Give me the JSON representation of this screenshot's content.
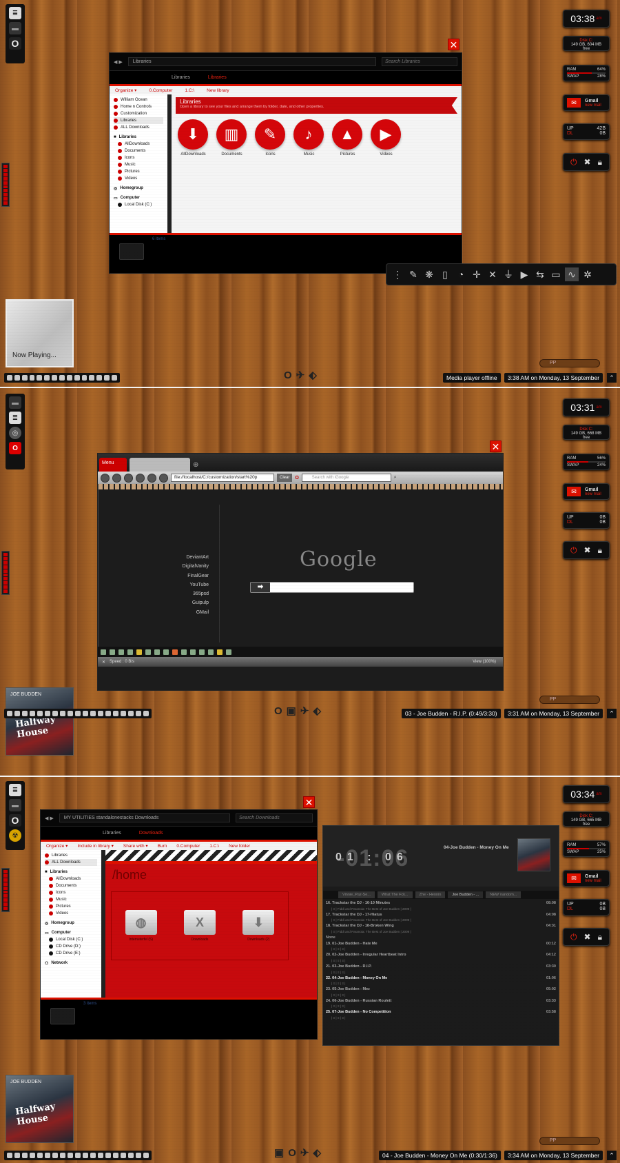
{
  "panel1": {
    "clock": {
      "time": "03:38",
      "ampm": "am"
    },
    "disk": {
      "label": "Disk C:",
      "value": "149 GB, 604 MB free"
    },
    "ram": {
      "ram_label": "RAM",
      "ram_val": "64%",
      "swap_label": "SWAP",
      "swap_val": "28%",
      "ram_pct": 64,
      "swap_pct": 28
    },
    "gmail": {
      "title": "Gmail",
      "sub": "new mail"
    },
    "net": {
      "up_label": "UP",
      "up": "42B",
      "dl_label": "DL",
      "dl": "0B"
    },
    "explorer": {
      "address": "Libraries",
      "search": "Search Libraries",
      "tabs": [
        "Libraries",
        "Libraries"
      ],
      "commands": [
        "Organize ▾",
        "0.Computer",
        "1.C:\\",
        "New library"
      ],
      "nav": [
        "William Ocean",
        "Home n Controls",
        "Customization",
        "Libraries",
        "ALL Downloads"
      ],
      "nav_libs_header": "Libraries",
      "nav_libs": [
        "AllDownloads",
        "Documents",
        "Icons",
        "Music",
        "Pictures",
        "Videos"
      ],
      "homegroup": "Homegroup",
      "computer": "Computer",
      "local_disk": "Local Disk (C:)",
      "banner_title": "Libraries",
      "banner_sub": "Open a library to see your files and arrange them by folder, date, and other properties.",
      "libraries": [
        "AllDownloads",
        "Documents",
        "Icons",
        "Music",
        "Pictures",
        "Videos"
      ],
      "status": "6 items"
    },
    "now_playing": "Now Playing...",
    "media_status": "Media player offline",
    "datetime": "3:38 AM on Monday, 13 September",
    "search_placeholder": "PP"
  },
  "panel2": {
    "clock": {
      "time": "03:31",
      "ampm": "am"
    },
    "disk": {
      "label": "Disk C:",
      "value": "149 GB, 668 MB free"
    },
    "ram": {
      "ram_label": "RAM",
      "ram_val": "56%",
      "swap_label": "SWAP",
      "swap_val": "24%",
      "ram_pct": 56,
      "swap_pct": 24
    },
    "gmail": {
      "title": "Gmail",
      "sub": "new mail"
    },
    "net": {
      "up_label": "UP",
      "up": "0B",
      "dl_label": "DL",
      "dl": "0B"
    },
    "browser": {
      "menu": "Menu",
      "url": "file://localhost/C:/customization/start%20p",
      "go": "Clear",
      "search": "Search with iGoogle",
      "links": [
        "DeviantArt",
        "DigitalVanity",
        "FinalGear",
        "YouTube",
        "365psd",
        "Guipulp",
        "GMail"
      ],
      "logo": "Google",
      "speed": "Speed : 0 B/s",
      "zoom": "View (100%)"
    },
    "track": "03 - Joe Budden - R.I.P. (0:49/3:30)",
    "datetime": "3:31 AM on Monday, 13 September",
    "album_artist": "JOE BUDDEN",
    "album_title": "Halfway House",
    "search_placeholder": "PP"
  },
  "panel3": {
    "clock": {
      "time": "03:34",
      "ampm": "am"
    },
    "disk": {
      "label": "Disk C:",
      "value": "149 GB, 665 MB free"
    },
    "ram": {
      "ram_label": "RAM",
      "ram_val": "57%",
      "swap_label": "SWAP",
      "swap_val": "25%",
      "ram_pct": 57,
      "swap_pct": 25
    },
    "gmail": {
      "title": "Gmail",
      "sub": "new mail"
    },
    "net": {
      "up_label": "UP",
      "up": "0B",
      "dl_label": "DL",
      "dl": "0B"
    },
    "explorer": {
      "address": "MY UTILITIES   standalonestacks   Downloads",
      "search": "Search Downloads",
      "tabs": [
        "Libraries",
        "Downloads"
      ],
      "commands": [
        "Organize ▾",
        "Include in library ▾",
        "Share with ▾",
        "Burn",
        "0.Computer",
        "1.C:\\",
        "New folder"
      ],
      "nav": [
        "Libraries",
        "ALL Downloads"
      ],
      "nav_libs_header": "Libraries",
      "nav_libs": [
        "AllDownloads",
        "Documents",
        "Icons",
        "Music",
        "Pictures",
        "Videos"
      ],
      "homegroup": "Homegroup",
      "computer": "Computer",
      "drives": [
        "Local Disk (C:)",
        "CD Drive (D:)",
        "CD Drive (E:)"
      ],
      "network": "Network",
      "home_title": "/home",
      "folders": [
        "Interneterfel (S)",
        "Downloads",
        "Downloads (2)"
      ],
      "status": "3 items"
    },
    "player": {
      "time_big": "-01:06",
      "time_small": "01 : 06",
      "now": "04-Joe Budden - Money On Me",
      "tabs": [
        "Vinnie_Paz-Se...",
        "What The Fck...",
        "Zhe - Hennin",
        "Joe Budden - ...",
        "NEW \\random..."
      ],
      "active_tab": 3,
      "tracks": [
        {
          "n": "16. Trackstar the DJ - 16-10 Minutes",
          "t": "08:08",
          "sub": "| ≡ | Fiddi and Paranoia: The Best of Joe Budden | 2009 |"
        },
        {
          "n": "17. Trackstar the DJ - 17-Hiatus",
          "t": "04:08",
          "sub": "| ≡ | Fiddi and Paranoia: The Best of Joe Budden | 2009 |"
        },
        {
          "n": "18. Trackstar the DJ - 18-Broken Wing",
          "t": "04:31",
          "sub": "| ≡ | Fiddi and Paranoia: The Best of Joe Budden | 2009 |"
        }
      ],
      "none_label": "None",
      "tracks2": [
        {
          "n": "19. 01-Joe Budden - Hate Me",
          "t": "00:12",
          "sub": "| ≡ | ≡ | ≡ |"
        },
        {
          "n": "20. 02-Joe Budden - Irregular Heartbeat Intro",
          "t": "04:12",
          "sub": "| ≡ | ≡ | ≡ |"
        },
        {
          "n": "21. 03-Joe Budden - R.I.P.",
          "t": "03:30",
          "sub": "| ≡ | ≡ | ≡ |"
        },
        {
          "n": "22. 04-Joe Budden - Money On Me",
          "t": "01:06",
          "sub": "| ≡ | ≡ | ≡ |"
        },
        {
          "n": "23. 05-Joe Budden - Mez",
          "t": "05:02",
          "sub": "| ≡ | ≡ | ≡ |"
        },
        {
          "n": "24. 06-Joe Budden - Russian Roulett",
          "t": "03:33",
          "sub": "| ≡ | ≡ | ≡ |"
        },
        {
          "n": "25. 07-Joe Budden - No Competition",
          "t": "03:58",
          "sub": "| ≡ | ≡ | ≡ |"
        }
      ]
    },
    "track": "04 - Joe Budden - Money On Me  (0:30/1:36)",
    "datetime": "3:34 AM on Monday, 13 September",
    "album_artist": "JOE BUDDEN",
    "album_title": "Halfway House",
    "search_placeholder": "PP"
  },
  "colors": {
    "accent": "#d10a0a",
    "wood": "#9b5b24",
    "dark": "#0d0d0d"
  },
  "icons": {
    "close": "close-icon",
    "power": "power-icon",
    "lock": "lock-icon",
    "mail": "mail-icon"
  }
}
